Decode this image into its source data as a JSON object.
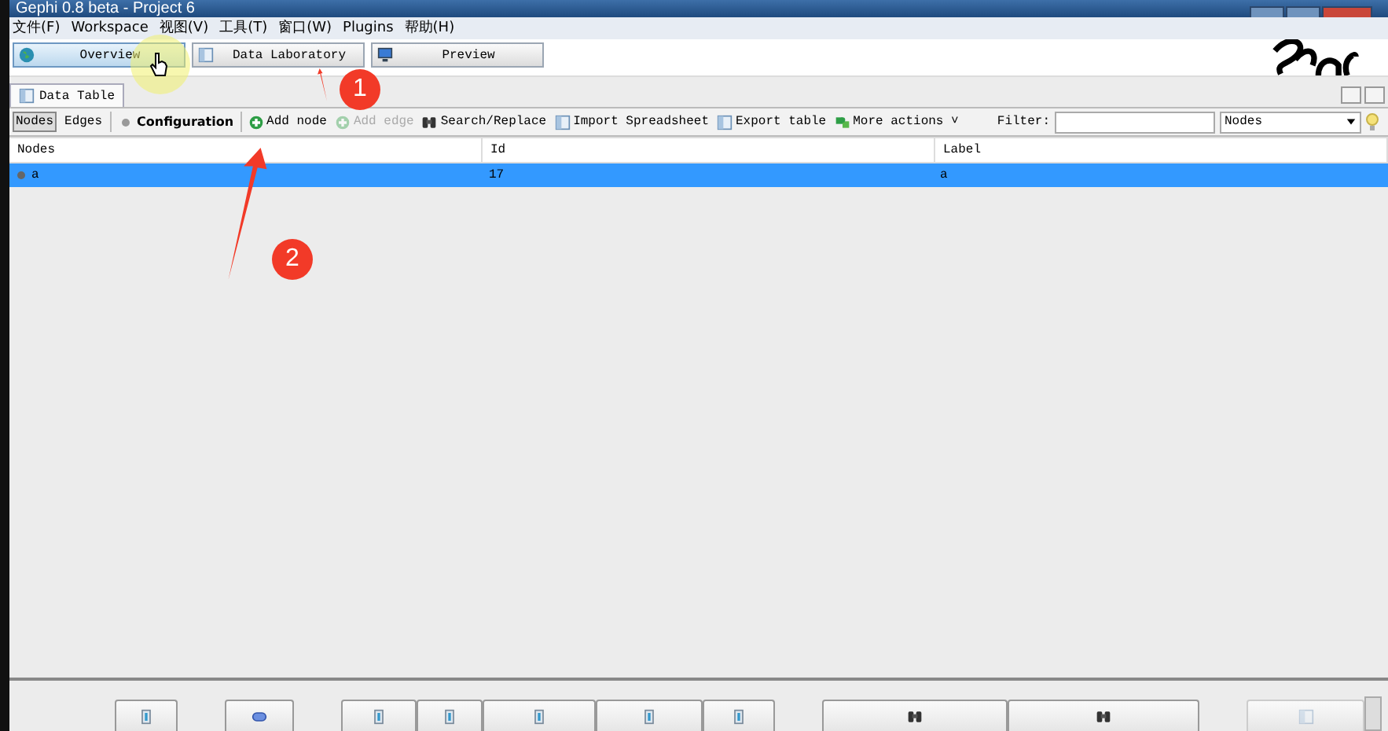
{
  "window": {
    "title": "Gephi 0.8 beta - Project 6"
  },
  "menu": [
    "文件(F)",
    "Workspace",
    "视图(V)",
    "工具(T)",
    "窗口(W)",
    "Plugins",
    "帮助(H)"
  ],
  "workspaces": [
    {
      "label": "Overview",
      "hovered": true,
      "kind": "globe"
    },
    {
      "label": "Data Laboratory",
      "hovered": false,
      "kind": "sheet"
    },
    {
      "label": "Preview",
      "hovered": false,
      "kind": "monitor"
    }
  ],
  "tabs": [
    {
      "label": "Data Table",
      "selected": true
    }
  ],
  "toolbar": {
    "views": [
      {
        "label": "Nodes",
        "selected": true
      },
      {
        "label": "Edges",
        "selected": false
      }
    ],
    "actions": [
      {
        "label": "Configuration",
        "kind": "config",
        "disabled": false
      },
      {
        "label": "Add node",
        "kind": "add",
        "disabled": false
      },
      {
        "label": "Add edge",
        "kind": "add",
        "disabled": true
      },
      {
        "label": "Search/Replace",
        "kind": "search",
        "disabled": false
      },
      {
        "label": "Import Spreadsheet",
        "kind": "sheet",
        "disabled": false
      },
      {
        "label": "Export table",
        "kind": "sheet",
        "disabled": false
      },
      {
        "label": "More actions ˅",
        "kind": "puzzle",
        "disabled": false
      }
    ],
    "filter_label": "Filter:",
    "filter_column": "Nodes"
  },
  "table": {
    "columns": [
      "Nodes",
      "Id",
      "Label"
    ],
    "rows": [
      {
        "cells": [
          "a",
          "17",
          "a"
        ],
        "selected": true
      }
    ]
  },
  "annotations": [
    {
      "number": "1"
    },
    {
      "number": "2"
    }
  ]
}
